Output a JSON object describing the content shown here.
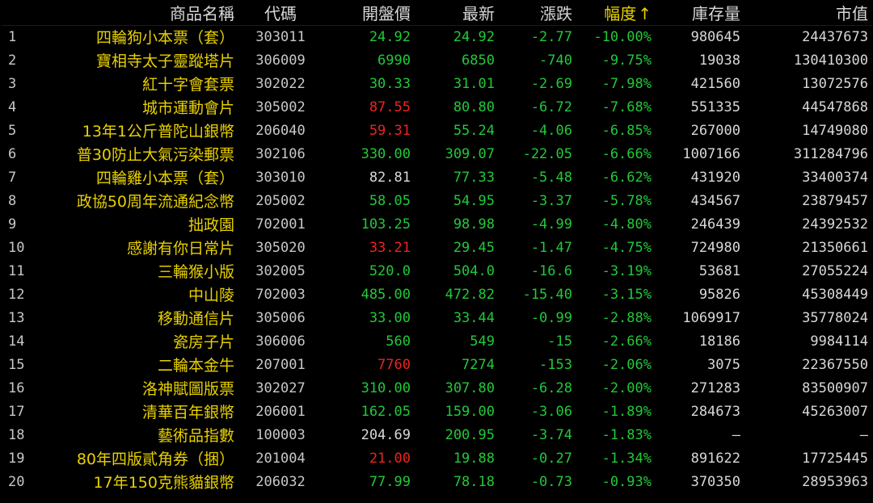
{
  "columns": {
    "name": "商品名稱",
    "code": "代碼",
    "open": "開盤價",
    "latest": "最新",
    "change": "漲跌",
    "pct": "幅度",
    "pct_sort_icon": "↑",
    "stock": "庫存量",
    "mcap": "市值"
  },
  "colors": {
    "green": "#22c83a",
    "red": "#ee2222",
    "white": "#d8d8d8",
    "name": "#e8d000"
  },
  "rows": [
    {
      "idx": "1",
      "name": "四輪狗小本票（套）",
      "code": "303011",
      "open": "24.92",
      "open_color": "green",
      "latest": "24.92",
      "change": "-2.77",
      "pct": "-10.00%",
      "stock": "980645",
      "mcap": "24437673"
    },
    {
      "idx": "2",
      "name": "寶相寺太子靈蹤塔片",
      "code": "306009",
      "open": "6990",
      "open_color": "green",
      "latest": "6850",
      "change": "-740",
      "pct": "-9.75%",
      "stock": "19038",
      "mcap": "130410300"
    },
    {
      "idx": "3",
      "name": "紅十字會套票",
      "code": "302022",
      "open": "30.33",
      "open_color": "green",
      "latest": "31.01",
      "change": "-2.69",
      "pct": "-7.98%",
      "stock": "421560",
      "mcap": "13072576"
    },
    {
      "idx": "4",
      "name": "城市運動會片",
      "code": "305002",
      "open": "87.55",
      "open_color": "red",
      "latest": "80.80",
      "change": "-6.72",
      "pct": "-7.68%",
      "stock": "551335",
      "mcap": "44547868"
    },
    {
      "idx": "5",
      "name": "13年1公斤普陀山銀幣",
      "code": "206040",
      "open": "59.31",
      "open_color": "red",
      "latest": "55.24",
      "change": "-4.06",
      "pct": "-6.85%",
      "stock": "267000",
      "mcap": "14749080"
    },
    {
      "idx": "6",
      "name": "普30防止大氣污染郵票",
      "code": "302106",
      "open": "330.00",
      "open_color": "green",
      "latest": "309.07",
      "change": "-22.05",
      "pct": "-6.66%",
      "stock": "1007166",
      "mcap": "311284796"
    },
    {
      "idx": "7",
      "name": "四輪雞小本票（套）",
      "code": "303010",
      "open": "82.81",
      "open_color": "white",
      "latest": "77.33",
      "change": "-5.48",
      "pct": "-6.62%",
      "stock": "431920",
      "mcap": "33400374"
    },
    {
      "idx": "8",
      "name": "政協50周年流通紀念幣",
      "code": "205002",
      "open": "58.05",
      "open_color": "green",
      "latest": "54.95",
      "change": "-3.37",
      "pct": "-5.78%",
      "stock": "434567",
      "mcap": "23879457"
    },
    {
      "idx": "9",
      "name": "拙政園",
      "code": "702001",
      "open": "103.25",
      "open_color": "green",
      "latest": "98.98",
      "change": "-4.99",
      "pct": "-4.80%",
      "stock": "246439",
      "mcap": "24392532"
    },
    {
      "idx": "10",
      "name": "感謝有你日常片",
      "code": "305020",
      "open": "33.21",
      "open_color": "red",
      "latest": "29.45",
      "change": "-1.47",
      "pct": "-4.75%",
      "stock": "724980",
      "mcap": "21350661"
    },
    {
      "idx": "11",
      "name": "三輪猴小版",
      "code": "302005",
      "open": "520.0",
      "open_color": "green",
      "latest": "504.0",
      "change": "-16.6",
      "pct": "-3.19%",
      "stock": "53681",
      "mcap": "27055224"
    },
    {
      "idx": "12",
      "name": "中山陵",
      "code": "702003",
      "open": "485.00",
      "open_color": "green",
      "latest": "472.82",
      "change": "-15.40",
      "pct": "-3.15%",
      "stock": "95826",
      "mcap": "45308449"
    },
    {
      "idx": "13",
      "name": "移動通信片",
      "code": "305006",
      "open": "33.00",
      "open_color": "green",
      "latest": "33.44",
      "change": "-0.99",
      "pct": "-2.88%",
      "stock": "1069917",
      "mcap": "35778024"
    },
    {
      "idx": "14",
      "name": "瓷房子片",
      "code": "306006",
      "open": "560",
      "open_color": "green",
      "latest": "549",
      "change": "-15",
      "pct": "-2.66%",
      "stock": "18186",
      "mcap": "9984114"
    },
    {
      "idx": "15",
      "name": "二輪本金牛",
      "code": "207001",
      "open": "7760",
      "open_color": "red",
      "latest": "7274",
      "change": "-153",
      "pct": "-2.06%",
      "stock": "3075",
      "mcap": "22367550"
    },
    {
      "idx": "16",
      "name": "洛神賦圖版票",
      "code": "302027",
      "open": "310.00",
      "open_color": "green",
      "latest": "307.80",
      "change": "-6.28",
      "pct": "-2.00%",
      "stock": "271283",
      "mcap": "83500907"
    },
    {
      "idx": "17",
      "name": "清華百年銀幣",
      "code": "206001",
      "open": "162.05",
      "open_color": "green",
      "latest": "159.00",
      "change": "-3.06",
      "pct": "-1.89%",
      "stock": "284673",
      "mcap": "45263007"
    },
    {
      "idx": "18",
      "name": "藝術品指數",
      "code": "100003",
      "open": "204.69",
      "open_color": "white",
      "latest": "200.95",
      "change": "-3.74",
      "pct": "-1.83%",
      "stock": "—",
      "mcap": "—"
    },
    {
      "idx": "19",
      "name": "80年四版貳角券（捆）",
      "code": "201004",
      "open": "21.00",
      "open_color": "red",
      "latest": "19.88",
      "change": "-0.27",
      "pct": "-1.34%",
      "stock": "891622",
      "mcap": "17725445"
    },
    {
      "idx": "20",
      "name": "17年150克熊貓銀幣",
      "code": "206032",
      "open": "77.99",
      "open_color": "green",
      "latest": "78.18",
      "change": "-0.73",
      "pct": "-0.93%",
      "stock": "370350",
      "mcap": "28953963"
    }
  ]
}
